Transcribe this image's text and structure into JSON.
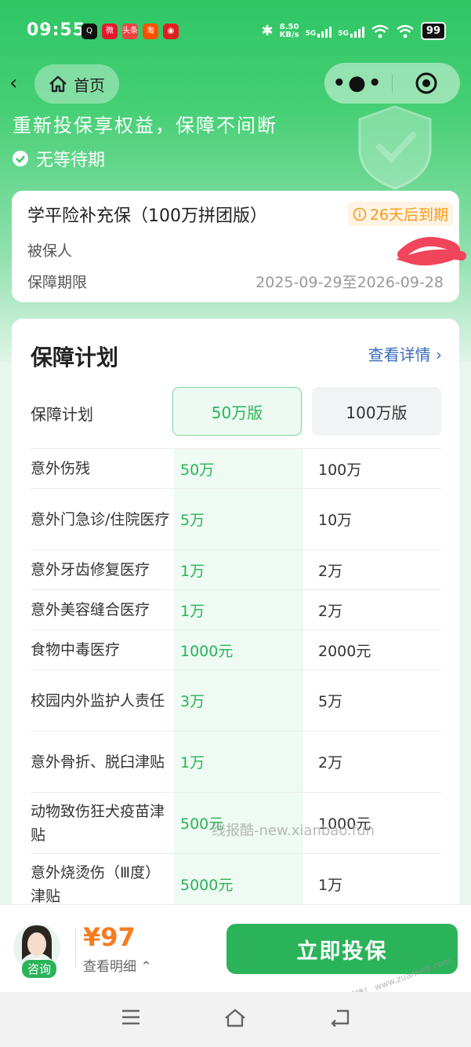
{
  "status": {
    "time": "09:55",
    "net_speed": "8.50",
    "net_unit": "KB/s",
    "sig1": "5G",
    "sig2": "5G",
    "battery": "99"
  },
  "status_apps": [
    {
      "name": "qq-icon",
      "glyph": "Q",
      "color": "#111"
    },
    {
      "name": "weibo-icon",
      "glyph": "微",
      "color": "#e6162d"
    },
    {
      "name": "toutiao-icon",
      "glyph": "头条",
      "color": "#f04142"
    },
    {
      "name": "taobao-icon",
      "glyph": "淘",
      "color": "#ff5000"
    },
    {
      "name": "app-icon",
      "glyph": "◉",
      "color": "#e02020"
    }
  ],
  "nav": {
    "home_label": "首页"
  },
  "hero": {
    "slogan": "重新投保享权益，保障不间断",
    "no_wait": "无等待期"
  },
  "policy": {
    "name": "学平险补充保（100万拼团版）",
    "expire_badge": "26天后到期",
    "insured_label": "被保人",
    "period_label": "保障期限",
    "period_value": "2025-09-29至2026-09-28"
  },
  "plan": {
    "title": "保障计划",
    "detail_link": "查看详情",
    "plan_label": "保障计划",
    "option_50": "50万版",
    "option_100": "100万版",
    "rows": [
      {
        "item": "意外伤残",
        "v50": "50万",
        "v100": "100万"
      },
      {
        "item": "意外门急诊/住院医疗",
        "v50": "5万",
        "v100": "10万"
      },
      {
        "item": "意外牙齿修复医疗",
        "v50": "1万",
        "v100": "2万"
      },
      {
        "item": "意外美容缝合医疗",
        "v50": "1万",
        "v100": "2万"
      },
      {
        "item": "食物中毒医疗",
        "v50": "1000元",
        "v100": "2000元"
      },
      {
        "item": "校园内外监护人责任",
        "v50": "3万",
        "v100": "5万"
      },
      {
        "item": "意外骨折、脱臼津贴",
        "v50": "1万",
        "v100": "2万"
      },
      {
        "item": "动物致伤狂犬疫苗津贴",
        "v50": "500元",
        "v100": "1000元"
      },
      {
        "item": "意外烧烫伤（Ⅲ度）津贴",
        "v50": "5000元",
        "v100": "1万"
      }
    ]
  },
  "watermark": "线报酷-new.xianbao.fun",
  "bottom": {
    "consult": "咨询",
    "price": "¥97",
    "price_detail": "查看明细",
    "buy_button": "立即投保"
  },
  "corner_watermark": "赚客吧，有奖一起赚！ www.zuanke8.com",
  "colors": {
    "brand_green": "#2bb35a",
    "price_orange": "#f57c1f",
    "expire_orange": "#f49a1b"
  }
}
